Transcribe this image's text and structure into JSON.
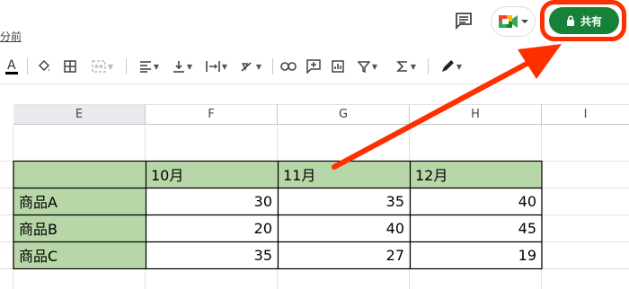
{
  "header": {
    "last_edit": "分前",
    "share_label": "共有"
  },
  "columns": [
    "E",
    "F",
    "G",
    "H",
    "I"
  ],
  "table": {
    "header_row": [
      "",
      "10月",
      "11月",
      "12月"
    ],
    "rows": [
      {
        "label": "商品A",
        "values": [
          "30",
          "35",
          "40"
        ]
      },
      {
        "label": "商品B",
        "values": [
          "20",
          "40",
          "45"
        ]
      },
      {
        "label": "商品C",
        "values": [
          "35",
          "27",
          "19"
        ]
      }
    ]
  },
  "colors": {
    "share_bg": "#188038",
    "highlight_red": "#ff2f00",
    "header_fill": "#b7d7a8"
  },
  "icons": [
    "comment-icon",
    "meet-icon",
    "lock-icon",
    "text-color-icon",
    "fill-color-icon",
    "borders-icon",
    "merge-cells-icon",
    "align-horizontal-icon",
    "align-vertical-icon",
    "text-wrap-icon",
    "text-rotation-icon",
    "insert-link-icon",
    "insert-comment-icon",
    "insert-chart-icon",
    "filter-icon",
    "functions-icon",
    "pen-icon"
  ]
}
